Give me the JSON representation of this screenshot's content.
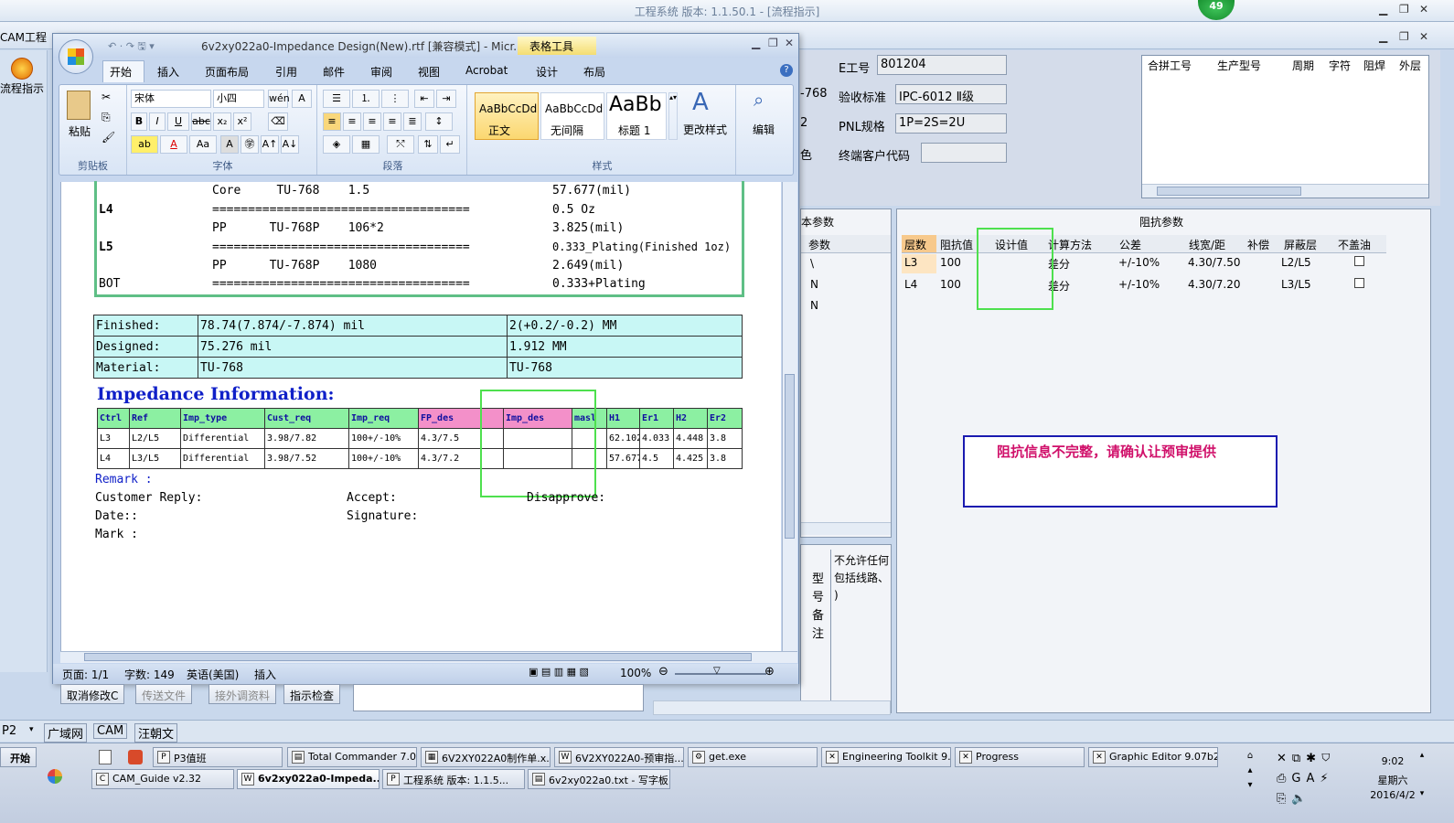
{
  "outer": {
    "title": "工程系统   版本: 1.1.50.1 - [流程指示]",
    "badge": "49",
    "cam_label": "CAM工程",
    "flow_label": "流程指示"
  },
  "word": {
    "title": "6v2xy022a0-Impedance Design(New).rtf [兼容模式] - Micr...",
    "tools_label": "表格工具",
    "tabs": [
      "开始",
      "插入",
      "页面布局",
      "引用",
      "邮件",
      "审阅",
      "视图",
      "Acrobat",
      "设计",
      "布局"
    ],
    "ribbon": {
      "clipboard_label": "剪贴板",
      "paste_label": "粘贴",
      "font_label": "字体",
      "font_name": "宋体",
      "font_size": "小四",
      "paragraph_label": "段落",
      "styles_label": "样式",
      "style_normal": "正文",
      "style_nospace": "无间隔",
      "style_heading": "标题 1",
      "style_preview_normal": "AaBbCcDd",
      "style_preview_nospace": "AaBbCcDd",
      "style_preview_heading": "AaBb",
      "change_style": "更改样式",
      "edit_label": "编辑"
    },
    "stack_lines": [
      {
        "layer": "",
        "col2": "Core     TU-768    1.5",
        "col3": "57.677(mil)"
      },
      {
        "layer": "L4",
        "col2": "====================================",
        "col3": "0.5 Oz"
      },
      {
        "layer": "",
        "col2": "PP      TU-768P    106*2",
        "col3": "3.825(mil)"
      },
      {
        "layer": "L5",
        "col2": "====================================",
        "col3": "0.333_Plating(Finished 1oz)"
      },
      {
        "layer": "",
        "col2": "PP      TU-768P    1080",
        "col3": "2.649(mil)"
      },
      {
        "layer": "BOT",
        "col2": "====================================",
        "col3": "0.333+Plating"
      }
    ],
    "finished_table": [
      [
        "Finished:",
        "78.74(7.874/-7.874) mil",
        "2(+0.2/-0.2) MM"
      ],
      [
        "Designed:",
        "75.276 mil",
        "1.912 MM"
      ],
      [
        "Material:",
        "TU-768",
        "TU-768"
      ]
    ],
    "imp_heading": "Impedance Information:",
    "imp_headers": [
      "Ctrl",
      "Ref",
      "Imp_type",
      "Cust_req",
      "Imp_req",
      "FP_des",
      "",
      "Imp_des",
      "masl",
      "H1",
      "Er1",
      "H2",
      "Er2"
    ],
    "imp_rows": [
      [
        "L3",
        "L2/L5",
        "Differential",
        "3.98/7.82",
        "100+/-10%",
        "4.3/7.5",
        "",
        "",
        "",
        "62.102",
        "4.033",
        "4.448",
        "3.8"
      ],
      [
        "L4",
        "L3/L5",
        "Differential",
        "3.98/7.52",
        "100+/-10%",
        "4.3/7.2",
        "",
        "",
        "",
        "57.677",
        "4.5",
        "4.425",
        "3.8"
      ]
    ],
    "remark": "Remark :",
    "customer_reply": "Customer Reply:",
    "accept": "Accept:",
    "disapprove": "Disapprove:",
    "date": "Date::",
    "signature": "Signature:",
    "mark": "Mark :",
    "status": {
      "page": "页面: 1/1",
      "words": "字数: 149",
      "lang": "英语(美国)",
      "mode": "插入",
      "zoom": "100%"
    }
  },
  "form": {
    "e_label": "E工号",
    "e_value": "801204",
    "accept_std_label": "验收标准",
    "accept_std_value": "IPC-6012 Ⅱ级",
    "pnl_label": "PNL规格",
    "pnl_value": "1P=2S=2U",
    "end_cust_label": "终端客户代码",
    "end_cust_value": "",
    "partial_768": "-768",
    "partial_2": "2",
    "partial_color": "色"
  },
  "top_grid_headers": [
    "合拼工号",
    "生产型号",
    "周期",
    "字符",
    "阻焊",
    "外层"
  ],
  "params_left": {
    "title": "本参数",
    "header": "参数",
    "values": [
      "\\",
      "N",
      "N"
    ]
  },
  "imp_params": {
    "title": "阻抗参数",
    "headers": [
      "层数",
      "阻抗值",
      "",
      "设计值",
      "计算方法",
      "公差",
      "线宽/距",
      "补偿",
      "屏蔽层",
      "不盖油"
    ],
    "rows": [
      [
        "L3",
        "100",
        "",
        "",
        "差分",
        "+/-10%",
        "4.30/7.50",
        "",
        "L2/L5"
      ],
      [
        "L4",
        "100",
        "",
        "",
        "差分",
        "+/-10%",
        "4.30/7.20",
        "",
        "L3/L5"
      ]
    ],
    "alert": "阻抗信息不完整，请确认让预审提供"
  },
  "note_panel": {
    "vertical_label": "型号备注",
    "text1": "不允许任何",
    "text2": "包括线路、",
    "text3": ")"
  },
  "buttons": [
    "取消修改C",
    "传送文件",
    "接外调资料",
    "指示检查"
  ],
  "status_strip": [
    "P2",
    "广域网",
    "CAM",
    "汪朝文"
  ],
  "taskbar": {
    "start": "开始",
    "row1": [
      "P3值班",
      "Total Commander 7.0 ...",
      "6V2XY022A0制作单.x...",
      "6V2XY022A0-预审指...",
      "get.exe",
      "Engineering Toolkit 9....",
      "Progress",
      "Graphic Editor 9.07b2 ..."
    ],
    "row2": [
      "CAM_Guide v2.32",
      "6v2xy022a0-Impeda...",
      "工程系统  版本: 1.1.5...",
      "6v2xy022a0.txt - 写字板"
    ],
    "time": "9:02",
    "weekday": "星期六",
    "date": "2016/4/2"
  }
}
